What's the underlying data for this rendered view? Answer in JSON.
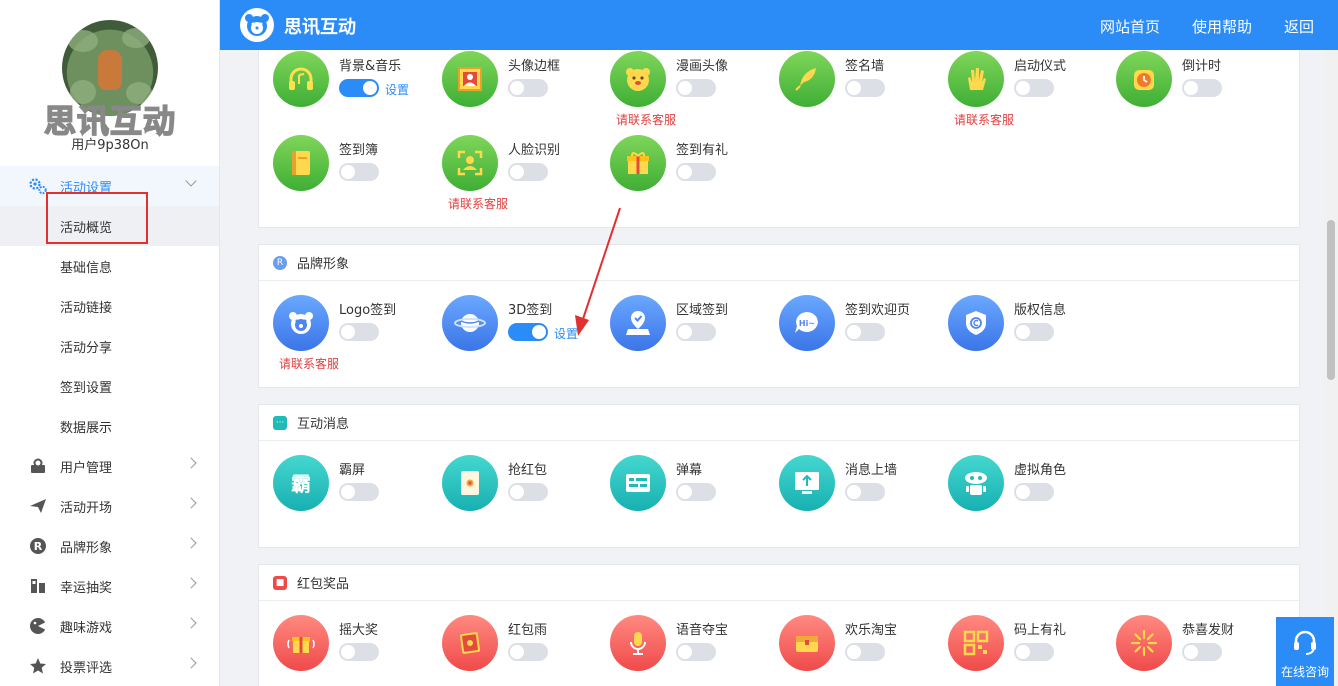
{
  "header": {
    "app_title": "思讯互动",
    "nav": [
      "网站首页",
      "使用帮助",
      "返回"
    ]
  },
  "sidebar": {
    "brand_text": "思讯互动",
    "username": "用户9p38On",
    "menu_open": {
      "label": "活动设置",
      "icon": "gears-icon"
    },
    "sub_items": [
      "活动概览",
      "基础信息",
      "活动链接",
      "活动分享",
      "签到设置",
      "数据展示"
    ],
    "active_sub_index": 0,
    "menu_items": [
      {
        "label": "用户管理",
        "icon": "user-manage-icon"
      },
      {
        "label": "活动开场",
        "icon": "paper-plane-icon"
      },
      {
        "label": "品牌形象",
        "icon": "registered-icon"
      },
      {
        "label": "幸运抽奖",
        "icon": "lottery-icon"
      },
      {
        "label": "趣味游戏",
        "icon": "game-icon"
      },
      {
        "label": "投票评选",
        "icon": "star-icon"
      }
    ]
  },
  "labels": {
    "set": "设置",
    "contact": "请联系客服"
  },
  "sections": {
    "sign": {
      "row1": [
        {
          "name": "背景&音乐",
          "icon": "headphones-icon",
          "on": true,
          "settings": true,
          "contact": false
        },
        {
          "name": "头像边框",
          "icon": "portrait-frame-icon",
          "on": false,
          "settings": false,
          "contact": false
        },
        {
          "name": "漫画头像",
          "icon": "cartoon-face-icon",
          "on": false,
          "settings": false,
          "contact": true
        },
        {
          "name": "签名墙",
          "icon": "quill-icon",
          "on": false,
          "settings": false,
          "contact": false
        },
        {
          "name": "启动仪式",
          "icon": "hand-icon",
          "on": false,
          "settings": false,
          "contact": true
        },
        {
          "name": "倒计时",
          "icon": "alarm-clock-icon",
          "on": false,
          "settings": false,
          "contact": false
        }
      ],
      "row2": [
        {
          "name": "签到簿",
          "icon": "book-icon",
          "on": false,
          "settings": false,
          "contact": false
        },
        {
          "name": "人脸识别",
          "icon": "face-scan-icon",
          "on": false,
          "settings": false,
          "contact": true
        },
        {
          "name": "签到有礼",
          "icon": "gift-icon",
          "on": false,
          "settings": false,
          "contact": false
        }
      ]
    },
    "brand": {
      "title": "品牌形象",
      "items": [
        {
          "name": "Logo签到",
          "icon": "bear-logo-icon",
          "on": false,
          "settings": false,
          "contact": true
        },
        {
          "name": "3D签到",
          "icon": "planet-icon",
          "on": true,
          "settings": true,
          "contact": false
        },
        {
          "name": "区域签到",
          "icon": "location-check-icon",
          "on": false,
          "settings": false,
          "contact": false
        },
        {
          "name": "签到欢迎页",
          "icon": "hi-bubble-icon",
          "on": false,
          "settings": false,
          "contact": false
        },
        {
          "name": "版权信息",
          "icon": "copyright-shield-icon",
          "on": false,
          "settings": false,
          "contact": false
        }
      ]
    },
    "interact": {
      "title": "互动消息",
      "items": [
        {
          "name": "霸屏",
          "icon": "ba-character-icon",
          "on": false
        },
        {
          "name": "抢红包",
          "icon": "red-envelope-icon",
          "on": false
        },
        {
          "name": "弹幕",
          "icon": "danmaku-icon",
          "on": false
        },
        {
          "name": "消息上墙",
          "icon": "screen-upload-icon",
          "on": false
        },
        {
          "name": "虚拟角色",
          "icon": "robot-icon",
          "on": false
        }
      ]
    },
    "prize": {
      "title": "红包奖品",
      "items": [
        {
          "name": "摇大奖",
          "icon": "shake-gift-icon",
          "on": false
        },
        {
          "name": "红包雨",
          "icon": "envelope-rain-icon",
          "on": false
        },
        {
          "name": "语音夺宝",
          "icon": "microphone-icon",
          "on": false
        },
        {
          "name": "欢乐淘宝",
          "icon": "treasure-chest-icon",
          "on": false
        },
        {
          "name": "码上有礼",
          "icon": "qr-code-icon",
          "on": false
        },
        {
          "name": "恭喜发财",
          "icon": "firework-icon",
          "on": false
        }
      ]
    }
  },
  "consult": {
    "label": "在线咨询"
  },
  "colors": {
    "accent": "#2b8cf7",
    "contact_red": "#e04040",
    "highlight_box": "#e03030"
  }
}
